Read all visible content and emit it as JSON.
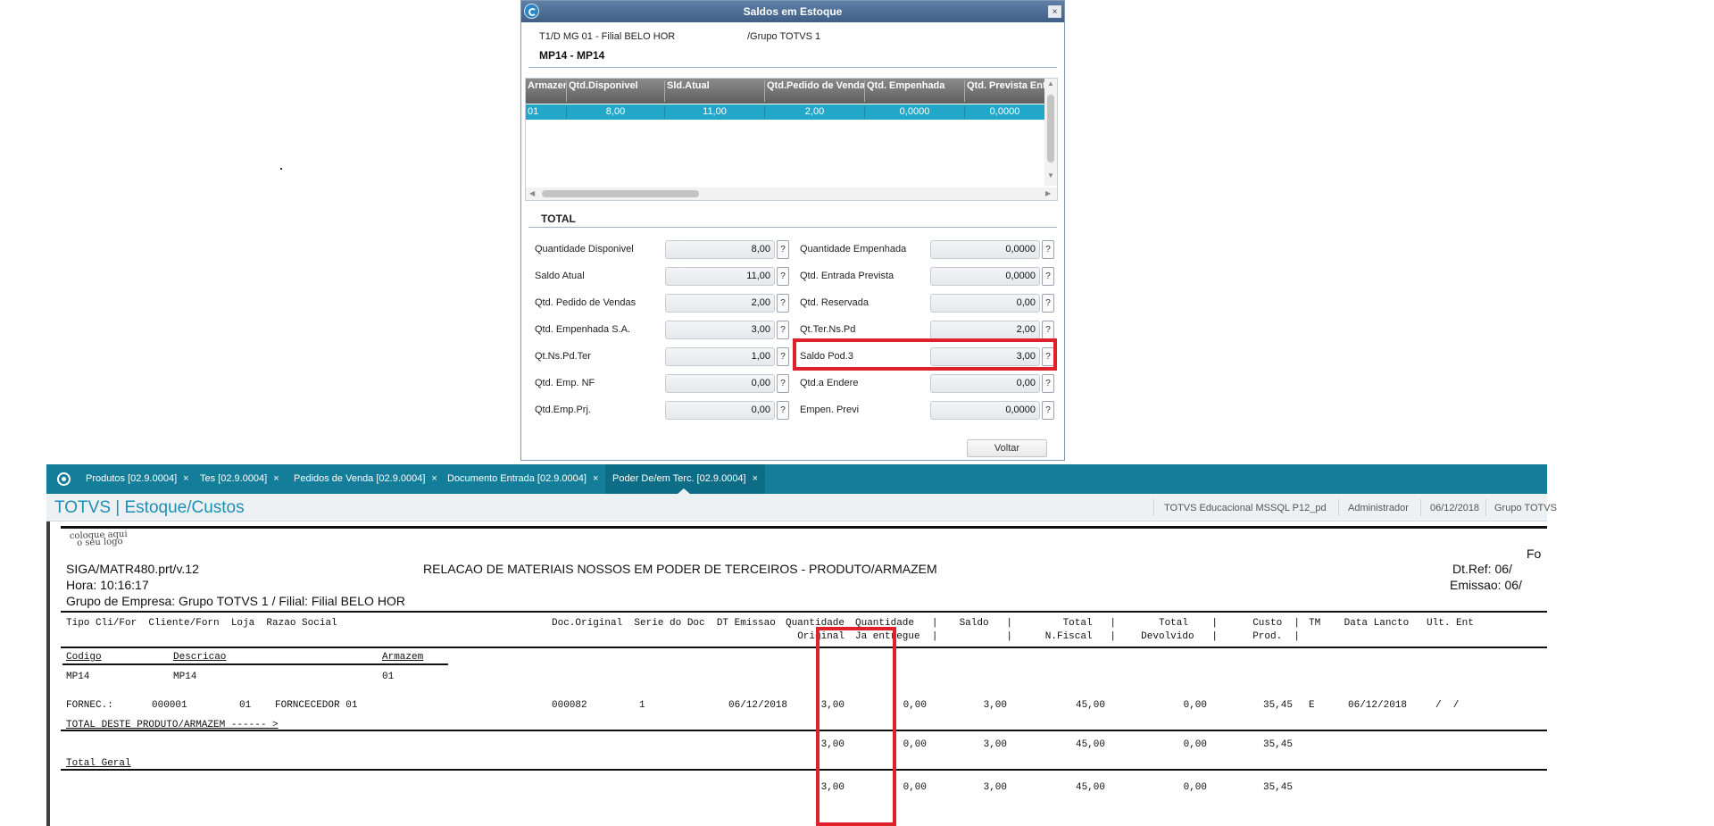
{
  "dialog": {
    "title": "Saldos em Estoque",
    "header_left": "T1/D MG 01  - Filial BELO HOR",
    "header_right": "/Grupo TOTVS 1",
    "product": "MP14 - MP14",
    "grid": {
      "columns": [
        "Armazem",
        "Qtd.Disponivel",
        "Sld.Atual",
        "Qtd.Pedido de Vendas",
        "Qtd. Empenhada",
        "Qtd. Prevista Entrada"
      ],
      "row": [
        "01",
        "8,00",
        "11,00",
        "2,00",
        "0,0000",
        "0,0000"
      ]
    },
    "total_label": "TOTAL",
    "fields_left": [
      {
        "label": "Quantidade Disponivel",
        "value": "8,00"
      },
      {
        "label": "Saldo Atual",
        "value": "11,00"
      },
      {
        "label": "Qtd. Pedido de Vendas",
        "value": "2,00"
      },
      {
        "label": "Qtd. Empenhada S.A.",
        "value": "3,00"
      },
      {
        "label": "Qt.Ns.Pd.Ter",
        "value": "1,00"
      },
      {
        "label": "Qtd. Emp. NF",
        "value": "0,00"
      },
      {
        "label": "Qtd.Emp.Prj.",
        "value": "0,00"
      }
    ],
    "fields_right": [
      {
        "label": "Quantidade Empenhada",
        "value": "0,0000"
      },
      {
        "label": "Qtd. Entrada Prevista",
        "value": "0,0000"
      },
      {
        "label": "Qtd. Reservada",
        "value": "0,00"
      },
      {
        "label": "Qt.Ter.Ns.Pd",
        "value": "2,00"
      },
      {
        "label": "Saldo Pod.3",
        "value": "3,00"
      },
      {
        "label": "Qtd.a Endere",
        "value": "0,00"
      },
      {
        "label": "Empen. Previ",
        "value": "0,0000"
      }
    ],
    "help_glyph": "?",
    "close_glyph": "×",
    "voltar_label": "Voltar"
  },
  "app": {
    "tabs": [
      {
        "label": "Produtos [02.9.0004]"
      },
      {
        "label": "Tes [02.9.0004]"
      },
      {
        "label": "Pedidos de Venda [02.9.0004]"
      },
      {
        "label": "Documento Entrada [02.9.0004]"
      },
      {
        "label": "Poder De/em Terc. [02.9.0004]"
      }
    ],
    "tab_close": "×",
    "title": "TOTVS | Estoque/Custos",
    "info": {
      "environment": "TOTVS Educacional MSSQL P12_pd",
      "user": "Administrador",
      "date": "06/12/2018",
      "group": "Grupo TOTVS"
    }
  },
  "report": {
    "logo_line1": "coloque aqui",
    "logo_line2": "o seu logo",
    "program": "SIGA/MATR480.prt/v.12",
    "title": "RELACAO DE MATERIAIS NOSSOS EM PODER DE TERCEIROS - PRODUTO/ARMAZEM",
    "time": "Hora: 10:16:17",
    "group": "Grupo de Empresa: Grupo TOTVS 1 / Filial: Filial BELO HOR",
    "right_top": "Fo",
    "dt_ref": "Dt.Ref: 06/",
    "emissao": "Emissao: 06/",
    "header_left": "Tipo Cli/For  Cliente/Forn  Loja  Razao Social",
    "header_doc": "Doc.Original  Serie do Doc  DT Emissao",
    "col_qtd_orig_1": "Quantidade",
    "col_qtd_orig_2": "Original",
    "col_qtd_entr_1": "Quantidade   |",
    "col_qtd_entr_2": "Ja entregue  |",
    "col_saldo_1": "Saldo   |",
    "col_saldo_2": "|",
    "col_nf_1": "Total   |",
    "col_nf_2": "N.Fiscal   |",
    "col_dev_1": "Total    |",
    "col_dev_2": "Devolvido   |",
    "col_custo_1": "Custo  |",
    "col_custo_2": "Prod.  |",
    "col_tail": "TM    Data Lancto   Ult. Ent",
    "sub_codigo": "Codigo",
    "sub_descricao": "Descricao",
    "sub_armazem": "Armazem",
    "prod_code": "MP14",
    "prod_desc": "MP14",
    "prod_arm": "01",
    "line": {
      "tipo": "FORNEC.:",
      "cliente": "000001",
      "loja": "01",
      "razao": "FORNCECEDOR 01",
      "doc": "000082",
      "serie": "1",
      "emissao": "06/12/2018",
      "qtd_orig": "3,00",
      "qtd_entr": "0,00",
      "saldo": "3,00",
      "nf": "45,00",
      "devolvido": "0,00",
      "custo": "35,45",
      "tm": "E",
      "data_lancto": "06/12/2018",
      "ult_ent": "/  /"
    },
    "total_product_label": "TOTAL DESTE PRODUTO/ARMAZEM ------ >",
    "total_product": [
      "3,00",
      "0,00",
      "3,00",
      "45,00",
      "0,00",
      "35,45"
    ],
    "total_geral_label": "Total Geral",
    "total_geral": [
      "3,00",
      "0,00",
      "3,00",
      "45,00",
      "0,00",
      "35,45"
    ]
  }
}
